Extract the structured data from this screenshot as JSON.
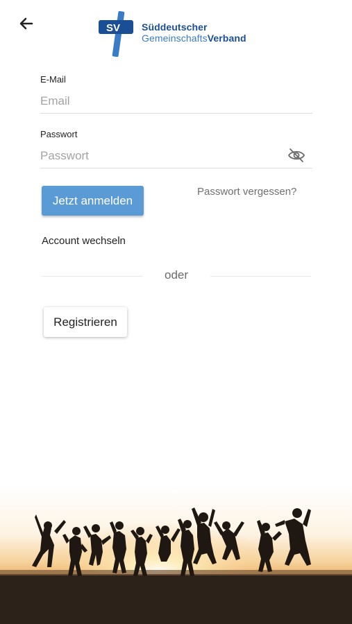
{
  "header": {
    "back_icon": "arrow-left-icon",
    "logo": {
      "mark_text": "SV",
      "line1": "Süddeutscher",
      "line2_regular": "Gemeinschafts",
      "line2_bold": "Verband",
      "brand_dark": "#1a4f96",
      "brand_light": "#3a7bc8"
    }
  },
  "form": {
    "email": {
      "label": "E-Mail",
      "placeholder": "Email",
      "value": ""
    },
    "password": {
      "label": "Passwort",
      "placeholder": "Passwort",
      "value": "",
      "toggle_icon": "eye-off-icon"
    },
    "login_button": "Jetzt anmelden",
    "forgot_link": "Passwort vergessen?",
    "switch_account": "Account wechseln",
    "divider_text": "oder",
    "register_button": "Registrieren"
  },
  "colors": {
    "primary": "#5b9bd5",
    "text": "#222222",
    "muted": "#6f6f6f",
    "placeholder": "#a3a3a3"
  },
  "footer_image": {
    "subject": "silhouettes of people jumping at sunset on a beach"
  }
}
